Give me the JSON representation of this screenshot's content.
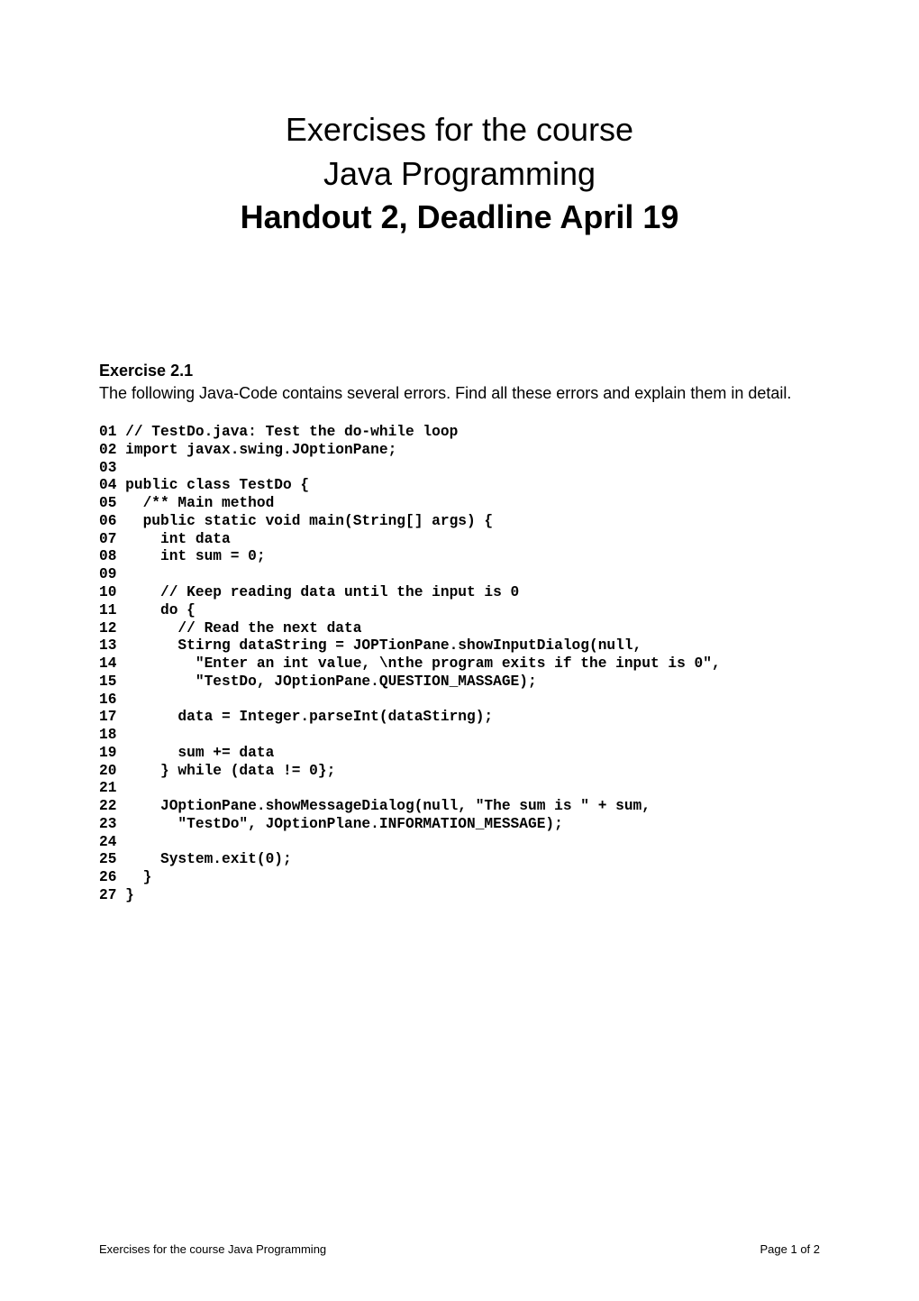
{
  "title": {
    "line1": "Exercises for the course",
    "line2": "Java Programming",
    "line3_bold": "Handout 2, Deadline April 19"
  },
  "exercise": {
    "heading": "Exercise 2.1",
    "intro": "The following Java-Code contains several errors. Find all these errors and explain them in detail."
  },
  "code": "01 // TestDo.java: Test the do-while loop\n02 import javax.swing.JOptionPane;\n03\n04 public class TestDo {\n05   /** Main method\n06   public static void main(String[] args) {\n07     int data\n08     int sum = 0;\n09\n10     // Keep reading data until the input is 0\n11     do {\n12       // Read the next data\n13       Stirng dataString = JOPTionPane.showInputDialog(null,\n14         \"Enter an int value, \\nthe program exits if the input is 0\",\n15         \"TestDo, JOptionPane.QUESTION_MASSAGE);\n16\n17       data = Integer.parseInt(dataStirng);\n18\n19       sum += data\n20     } while (data != 0};\n21\n22     JOptionPane.showMessageDialog(null, \"The sum is \" + sum,\n23       \"TestDo\", JOptionPlane.INFORMATION_MESSAGE);\n24\n25     System.exit(0);\n26   }\n27 }",
  "footer": {
    "left": "Exercises for the course Java Programming",
    "right": "Page 1 of 2"
  }
}
